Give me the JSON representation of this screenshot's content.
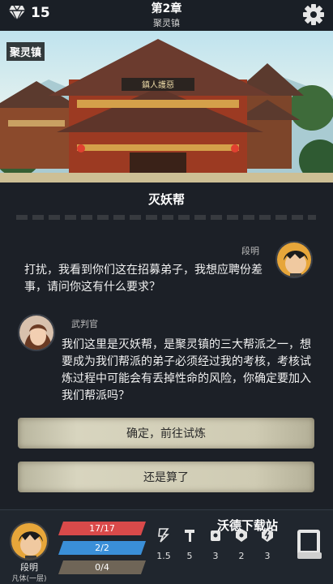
{
  "header": {
    "gem_icon": "diamond-icon",
    "gems": "15",
    "chapter": "第2章",
    "location": "聚灵镇",
    "settings_icon": "gear-icon"
  },
  "scene": {
    "label": "聚灵镇",
    "sign_text": "鎮人護惡"
  },
  "dialog": {
    "title": "灭妖帮",
    "messages": [
      {
        "speaker": "段明",
        "text": "打扰，我看到你们这在招募弟子，我想应聘份差事，请问你这有什么要求？"
      },
      {
        "speaker": "武判官",
        "text": "我们这里是灭妖帮，是聚灵镇的三大帮派之一，想要成为我们帮派的弟子必须经过我的考核，考核试炼过程中可能会有丢掉性命的风险，你确定要加入我们帮派吗？"
      }
    ],
    "choices": [
      "确定，前往试炼",
      "还是算了"
    ]
  },
  "player": {
    "name": "段明",
    "rank": "凡体(一层)",
    "hp": "17/17",
    "mp": "2/2",
    "exp": "0/4",
    "colors": {
      "hp": "#d94a4a",
      "mp": "#3a8fd8",
      "exp": "#6f6557"
    },
    "stats": [
      {
        "icon": "lightning-icon",
        "value": "1.5"
      },
      {
        "icon": "hammer-icon",
        "value": "5"
      },
      {
        "icon": "fist-icon",
        "value": "3"
      },
      {
        "icon": "shield-icon",
        "value": "2"
      },
      {
        "icon": "spark-icon",
        "value": "3"
      }
    ],
    "bag_icon": "book-icon"
  },
  "watermark": "沃德下载站"
}
